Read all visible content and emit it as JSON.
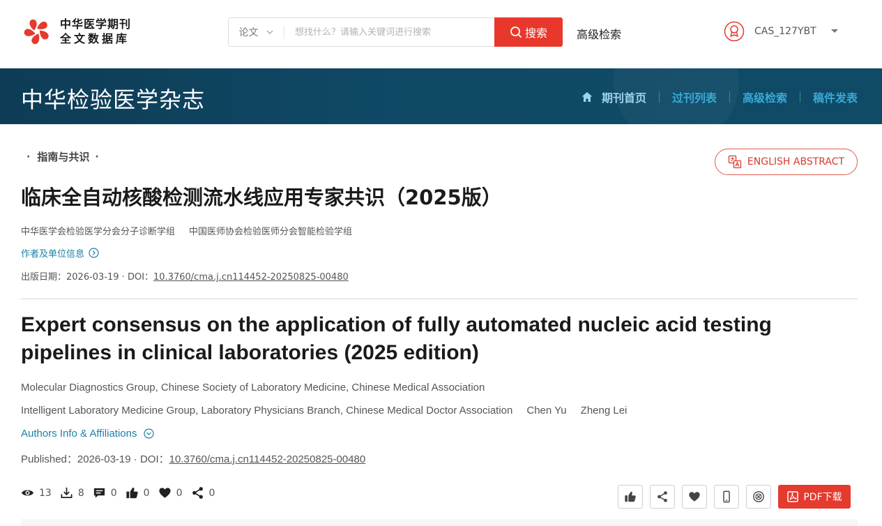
{
  "header": {
    "logo_line1": "中华医学期刊",
    "logo_line2": "全文数据库",
    "search_type": "论文",
    "search_placeholder": "想找什么？请输入关键词进行搜索",
    "search_button": "搜索",
    "advanced_search": "高级检索",
    "username": "CAS_127YBT"
  },
  "banner": {
    "journal_title": "中华检验医学杂志",
    "nav": [
      {
        "label": "期刊首页"
      },
      {
        "label": "过刊列表"
      },
      {
        "label": "高级检索"
      },
      {
        "label": "稿件发表"
      }
    ]
  },
  "article": {
    "section": "指南与共识",
    "english_abstract_button": "ENGLISH ABSTRACT",
    "cn_title": "临床全自动核酸检测流水线应用专家共识（2025版）",
    "cn_authors": [
      "中华医学会检验医学分会分子诊断学组",
      "中国医师协会检验医师分会智能检验学组"
    ],
    "cn_info_link": "作者及单位信息",
    "cn_pub_prefix": "出版日期：2026-03-19 · DOI：",
    "doi": "10.3760/cma.j.cn114452-20250825-00480",
    "en_title": "Expert consensus on the application of fully automated nucleic acid testing pipelines in clinical laboratories (2025 edition)",
    "en_affiliation_1": "Molecular Diagnostics Group, Chinese Society of Laboratory Medicine, Chinese Medical Association",
    "en_affiliation_2": "Intelligent Laboratory Medicine Group, Laboratory Physicians Branch, Chinese Medical Doctor Association",
    "en_author_1": "Chen Yu",
    "en_author_2": "Zheng Lei",
    "en_info_link": "Authors Info & Affiliations",
    "en_pub_prefix": "Published：2026-03-19 · DOI："
  },
  "stats": {
    "views": "13",
    "downloads": "8",
    "comments": "0",
    "likes": "0",
    "favorites": "0",
    "shares": "0"
  },
  "actions": {
    "pdf_button": "PDF下载"
  },
  "icons": {
    "logo": "flower-logo-icon",
    "search": "search-icon",
    "user": "user-badge-icon",
    "home": "home-icon",
    "translate": "translate-icon",
    "eye": "eye-icon",
    "download": "download-icon",
    "comment": "comment-icon",
    "thumb": "thumbs-up-icon",
    "heart": "heart-icon",
    "share": "share-icon",
    "mobile": "mobile-icon",
    "block": "block-icon",
    "pdf": "pdf-icon"
  },
  "colors": {
    "accent_red": "#e8382b",
    "banner_blue": "#0f4966",
    "link_blue": "#1a7fa6",
    "nav_blue": "#3aa9d6"
  }
}
